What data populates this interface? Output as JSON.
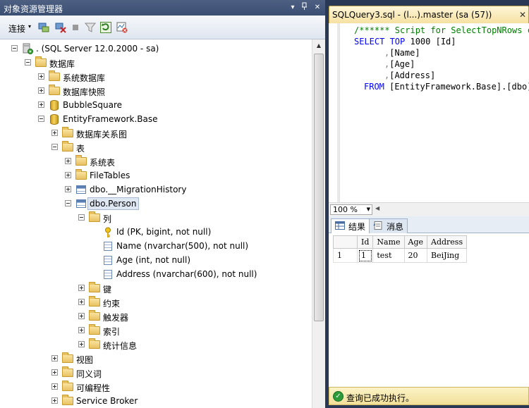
{
  "object_explorer": {
    "title": "对象资源管理器",
    "title_buttons": [
      "▾",
      "📌",
      "✕"
    ],
    "toolbar": {
      "connect_label": "连接",
      "connect_arrow": "▾"
    },
    "tree": [
      {
        "label": ". (SQL Server 12.0.2000 - sa)",
        "icon": "server-icon",
        "expander": "minus"
      },
      {
        "label": "数据库",
        "icon": "folder-icon",
        "expander": "minus"
      },
      {
        "label": "系统数据库",
        "icon": "folder-icon",
        "expander": "plus"
      },
      {
        "label": "数据库快照",
        "icon": "folder-icon",
        "expander": "plus"
      },
      {
        "label": "BubbleSquare",
        "icon": "database-icon",
        "expander": "plus"
      },
      {
        "label": "EntityFramework.Base",
        "icon": "database-icon",
        "expander": "minus"
      },
      {
        "label": "数据库关系图",
        "icon": "folder-icon",
        "expander": "plus"
      },
      {
        "label": "表",
        "icon": "folder-icon",
        "expander": "minus"
      },
      {
        "label": "系统表",
        "icon": "folder-icon",
        "expander": "plus"
      },
      {
        "label": "FileTables",
        "icon": "folder-icon",
        "expander": "plus"
      },
      {
        "label": "dbo.__MigrationHistory",
        "icon": "table-icon",
        "expander": "plus"
      },
      {
        "label": "dbo.Person",
        "icon": "table-icon",
        "expander": "minus",
        "selected": true
      },
      {
        "label": "列",
        "icon": "folder-icon",
        "expander": "minus"
      },
      {
        "label": "Id (PK, bigint, not null)",
        "icon": "key-icon",
        "expander": "none"
      },
      {
        "label": "Name (nvarchar(500), not null)",
        "icon": "column-icon",
        "expander": "none"
      },
      {
        "label": "Age (int, not null)",
        "icon": "column-icon",
        "expander": "none"
      },
      {
        "label": "Address (nvarchar(600), not null)",
        "icon": "column-icon",
        "expander": "none"
      },
      {
        "label": "键",
        "icon": "folder-icon",
        "expander": "plus"
      },
      {
        "label": "约束",
        "icon": "folder-icon",
        "expander": "plus"
      },
      {
        "label": "触发器",
        "icon": "folder-icon",
        "expander": "plus"
      },
      {
        "label": "索引",
        "icon": "folder-icon",
        "expander": "plus"
      },
      {
        "label": "统计信息",
        "icon": "folder-icon",
        "expander": "plus"
      },
      {
        "label": "视图",
        "icon": "folder-icon",
        "expander": "plus"
      },
      {
        "label": "同义词",
        "icon": "folder-icon",
        "expander": "plus"
      },
      {
        "label": "可编程性",
        "icon": "folder-icon",
        "expander": "plus"
      },
      {
        "label": "Service Broker",
        "icon": "folder-icon",
        "expander": "plus"
      }
    ]
  },
  "query_window": {
    "tab_title": "SQLQuery3.sql - (l...).master (sa (57))",
    "tab_close": "✕",
    "code": {
      "line1_comment": "/****** Script for SelectTopNRows co",
      "line2_kw": "SELECT TOP",
      "line2_rest": " 1000 [Id]",
      "line3_comma": ",",
      "line3_rest": "[Name]",
      "line4_comma": ",",
      "line4_rest": "[Age]",
      "line5_comma": ",",
      "line5_rest": "[Address]",
      "line6_kw": "FROM",
      "line6_rest": " [EntityFramework.Base].[dbo]."
    },
    "zoom": "100 %",
    "result_tabs": [
      "结果",
      "消息"
    ],
    "grid": {
      "columns": [
        "Id",
        "Name",
        "Age",
        "Address"
      ],
      "rows": [
        {
          "num": "1",
          "cells": [
            "1",
            "test",
            "20",
            "BeiJing"
          ]
        }
      ]
    },
    "status_text": "查询已成功执行。"
  },
  "colors": {
    "frame": "#293955",
    "status_bg": "#f2e099",
    "selected_node": "#dfe7f3"
  }
}
